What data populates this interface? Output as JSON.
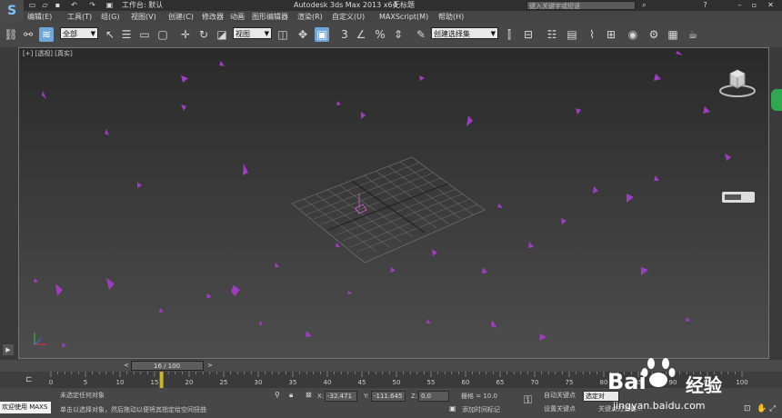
{
  "titlebar": {
    "workspace_label": "工作台: 默认",
    "app_title": "Autodesk 3ds Max  2013 x64",
    "doc_title": "无标题",
    "search_placeholder": "键入关键字或短语"
  },
  "logo": {
    "glyph": "S"
  },
  "menu": [
    "编辑(E)",
    "工具(T)",
    "组(G)",
    "视图(V)",
    "创建(C)",
    "修改器",
    "动画",
    "图形编辑器",
    "渲染(R)",
    "自定义(U)",
    "MAXScript(M)",
    "帮助(H)"
  ],
  "toolbar": {
    "selection_filter": "全部",
    "ref_coord": "视图",
    "named_selection": "创建选择集"
  },
  "viewport": {
    "label": "[+] [透视] [真实]"
  },
  "timeline": {
    "frame_counter": "16 / 100",
    "ticks": [
      "0",
      "5",
      "10",
      "15",
      "20",
      "25",
      "30",
      "35",
      "40",
      "45",
      "50",
      "55",
      "60",
      "65",
      "70",
      "75",
      "80",
      "85",
      "90",
      "95",
      "100"
    ],
    "current_frame": 16,
    "total_frames": 100
  },
  "status": {
    "welcome": "欢迎使用 MAXS",
    "selection_msg": "未选定任何对象",
    "prompt": "单击以选择对象，然后拖动以便将其指定给空间扭曲",
    "x_label": "X:",
    "x_value": "-32.471",
    "y_label": "Y:",
    "y_value": "-111.645",
    "z_label": "Z:",
    "z_value": "0.0",
    "grid": "栅格 = 10.0",
    "add_time_tag": "添加时间标记",
    "auto_key": "自动关键点",
    "set_key": "设置关键点",
    "selected_dd": "选定对",
    "key_filters": "关键点过滤器..."
  },
  "watermark": {
    "brand": "Bai",
    "brand2": "经验",
    "url": "jingyan.baidu.com"
  }
}
